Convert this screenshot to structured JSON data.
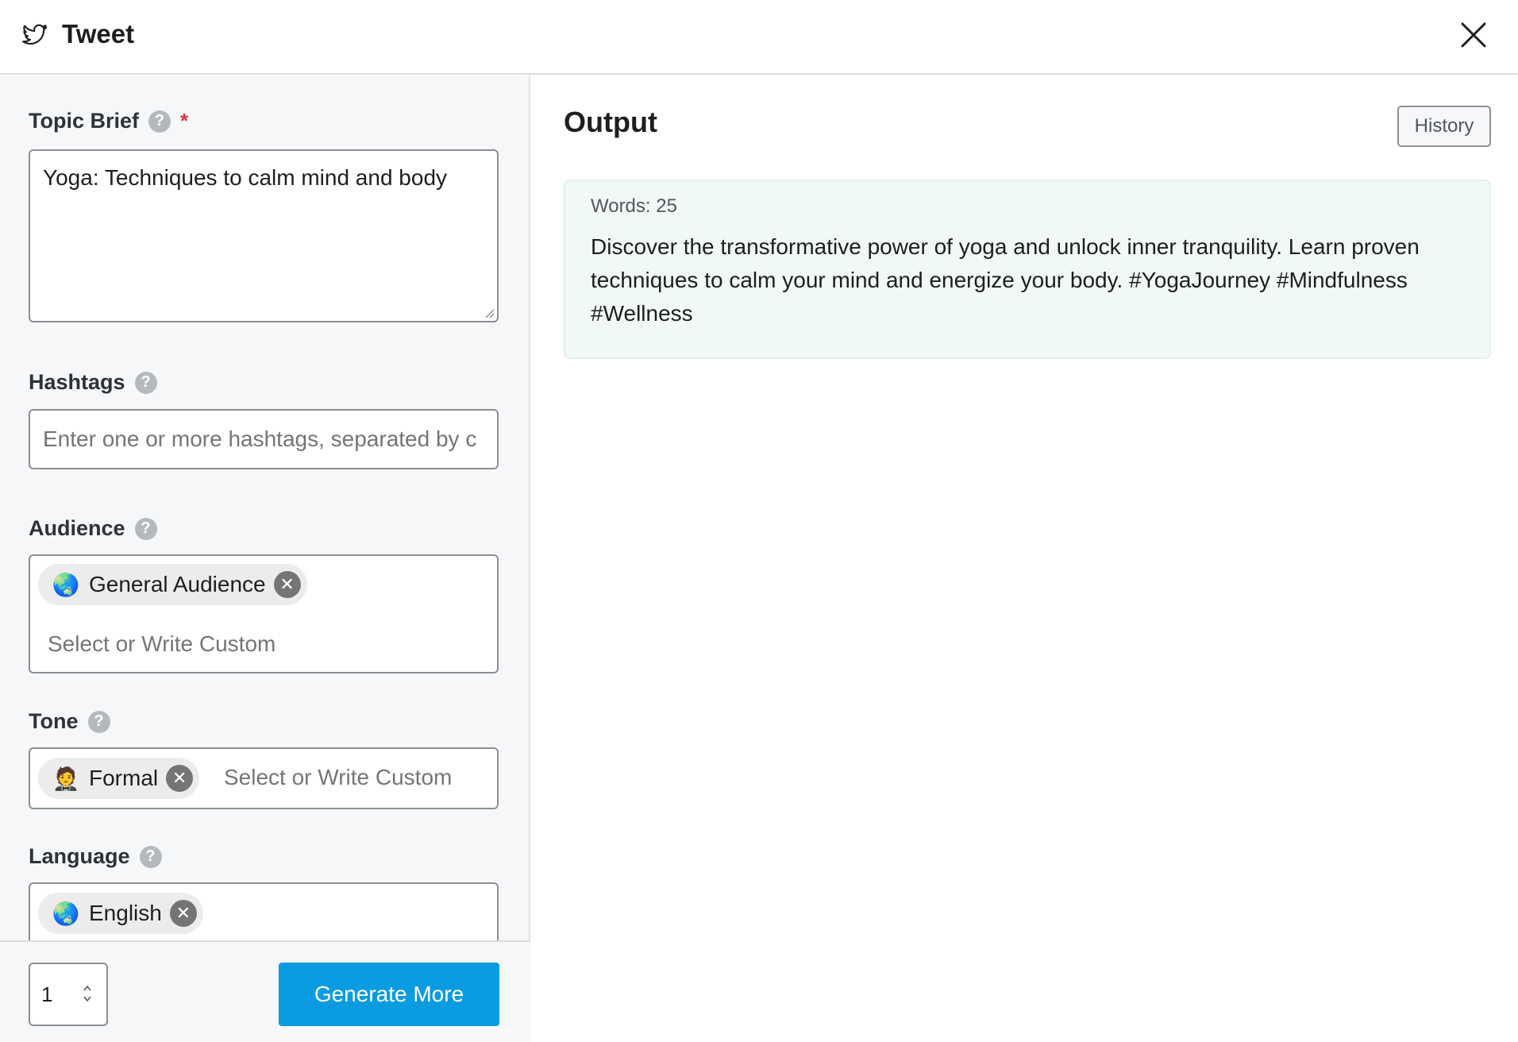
{
  "header": {
    "title": "Tweet",
    "icon": "twitter-bird-icon",
    "close_icon": "close-icon"
  },
  "form": {
    "topic": {
      "label": "Topic Brief",
      "required_mark": "*",
      "value": "Yoga: Techniques to calm mind and body"
    },
    "hashtags": {
      "label": "Hashtags",
      "placeholder": "Enter one or more hashtags, separated by c"
    },
    "audience": {
      "label": "Audience",
      "chip": {
        "emoji": "🌏",
        "label": "General Audience"
      },
      "placeholder": "Select or Write Custom"
    },
    "tone": {
      "label": "Tone",
      "chip": {
        "emoji": "🤵",
        "label": "Formal"
      },
      "placeholder": "Select or Write Custom"
    },
    "language": {
      "label": "Language",
      "chip": {
        "emoji": "🌏",
        "label": "English"
      }
    },
    "help_glyph": "?",
    "chip_remove_glyph": "✕"
  },
  "footer": {
    "count": "1",
    "generate_label": "Generate More"
  },
  "output": {
    "title": "Output",
    "history_label": "History",
    "words": "Words: 25",
    "text": "Discover the transformative power of yoga and unlock inner tranquility. Learn proven techniques to calm your mind and energize your body. #YogaJourney #Mindfulness #Wellness"
  },
  "colors": {
    "accent": "#0b9be0",
    "required": "#d63638",
    "result_bg": "#f0f9f6"
  }
}
